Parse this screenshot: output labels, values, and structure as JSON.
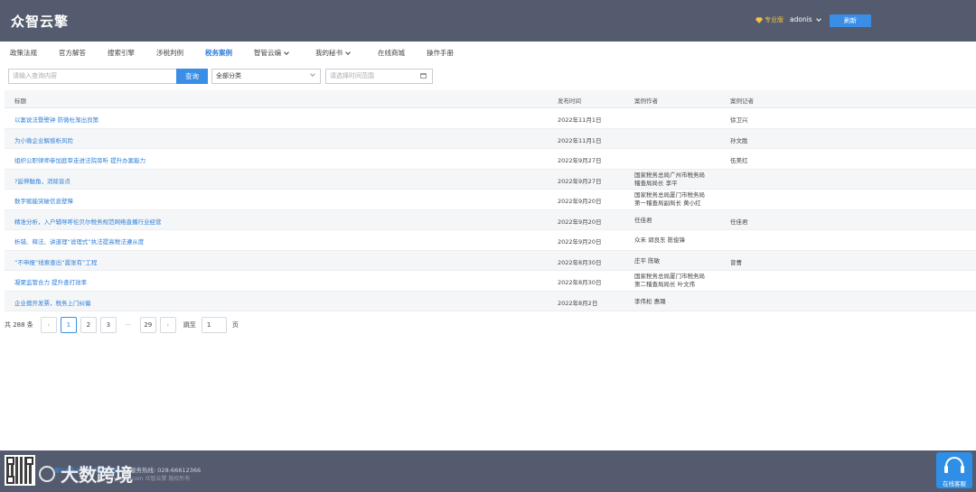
{
  "header": {
    "logo": "众智云擎",
    "edition": "专业版",
    "username": "adonis",
    "refresh_label": "刷新"
  },
  "nav": [
    {
      "label": "政策法规",
      "dropdown": false,
      "active": false
    },
    {
      "label": "官方解答",
      "dropdown": false,
      "active": false
    },
    {
      "label": "搜索引擎",
      "dropdown": false,
      "active": false
    },
    {
      "label": "涉税判例",
      "dropdown": false,
      "active": false
    },
    {
      "label": "税务案例",
      "dropdown": false,
      "active": true
    },
    {
      "label": "智管云编",
      "dropdown": true,
      "active": false
    },
    {
      "label": "我的秘书",
      "dropdown": true,
      "active": false
    },
    {
      "label": "在线商城",
      "dropdown": false,
      "active": false
    },
    {
      "label": "操作手册",
      "dropdown": false,
      "active": false
    }
  ],
  "search": {
    "placeholder": "请输入查询内容",
    "button_label": "查询",
    "category_value": "全部分类",
    "date_placeholder": "请选择时间范围"
  },
  "table": {
    "headers": {
      "title": "标题",
      "date": "发布时间",
      "author": "案例作者",
      "reporter": "案例记者"
    },
    "rows": [
      {
        "title": "以案说法暨警钟 防微杜渐出良策",
        "date": "2022年11月1日",
        "author": [],
        "reporter": "徐卫兴"
      },
      {
        "title": "为小微企业解惑析风险",
        "date": "2022年11月1日",
        "author": [],
        "reporter": "孙文胜"
      },
      {
        "title": "组织公职律师参加庭审走进法院旁听 提升办案能力",
        "date": "2022年9月27日",
        "author": [],
        "reporter": "伍美红"
      },
      {
        "title": "?延伸触角，消除盲点",
        "date": "2022年9月27日",
        "author": [
          "国家税务总局广州市税务局",
          "稽查局局长 李平"
        ],
        "reporter": ""
      },
      {
        "title": "数字赋能突破信息壁障",
        "date": "2022年9月20日",
        "author": [
          "国家税务总局厦门市税务局",
          "第一稽查局副局长 黄小红"
        ],
        "reporter": ""
      },
      {
        "title": "精准分析，入户辅导呼伦贝尔税务规范网络直播行业经营",
        "date": "2022年9月20日",
        "author": [
          "任佳君"
        ],
        "reporter": "任佳君"
      },
      {
        "title": "析错、释法、讲道理“说理式”执法提高税法遵从度",
        "date": "2022年9月20日",
        "author": [
          "众禾 郭良东 陈俊锋"
        ],
        "reporter": ""
      },
      {
        "title": "“不申报”线索查出“嚣张有”工程",
        "date": "2022年8月30日",
        "author": [
          "庄平 陈敏"
        ],
        "reporter": "曾曹"
      },
      {
        "title": "凝聚监管合力 提升查打效率",
        "date": "2022年8月30日",
        "author": [
          "国家税务总局厦门市税务局",
          "第二稽查局局长 叶文伟"
        ],
        "reporter": ""
      },
      {
        "title": "企业擅开发票，税务上门纠偏",
        "date": "2022年8月2日",
        "author": [
          "李伟松 惠璐"
        ],
        "reporter": ""
      }
    ]
  },
  "pagination": {
    "total": "共 288 条",
    "pages": [
      "1",
      "2",
      "3"
    ],
    "ellipsis": "···",
    "last_page": "29",
    "current": "1",
    "jump_label": "跳至",
    "jump_value": "1",
    "page_suffix": "页"
  },
  "footer": {
    "line1_link": "蜀ICP备2020000433号-1",
    "line1_text": " | 服务热线: 028-66612366",
    "line2": "bdyaxue.com 众智云擎 版权所有",
    "watermark": "大数跨境",
    "service_label": "在线客服"
  },
  "colors": {
    "header_bg": "#545b6e",
    "accent": "#3a8ee6",
    "link": "#2d7fd8",
    "edition": "#f5c242"
  }
}
